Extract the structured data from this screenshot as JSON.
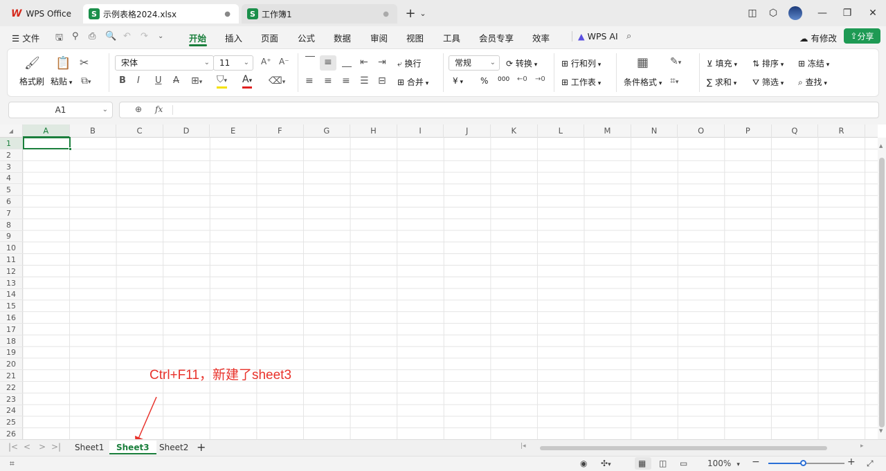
{
  "titlebar": {
    "app_tab": "WPS Office",
    "tabs": [
      {
        "icon": "S",
        "label": "示例表格2024.xlsx",
        "status": "●"
      },
      {
        "icon": "S",
        "label": "工作簿1",
        "status": "●"
      }
    ],
    "new_tab": "+",
    "tab_menu": "⌄"
  },
  "menubar": {
    "file": "文件",
    "items": [
      "开始",
      "插入",
      "页面",
      "公式",
      "数据",
      "审阅",
      "视图",
      "工具",
      "会员专享",
      "效率"
    ],
    "ai": "WPS AI",
    "changes": "有修改",
    "share": "分享"
  },
  "ribbon": {
    "format_painter": "格式刷",
    "paste": "粘贴",
    "font_name": "宋体",
    "font_size": "11",
    "wrap": "换行",
    "merge": "合并",
    "number_format": "常规",
    "convert": "转换",
    "rows_cols": "行和列",
    "worksheet": "工作表",
    "cond_format": "条件格式",
    "fill": "填充",
    "sort": "排序",
    "freeze": "冻结",
    "sum": "求和",
    "filter": "筛选",
    "find": "查找",
    "currency": "¥",
    "percent": "%",
    "thousands": "000"
  },
  "formula": {
    "cell_ref": "A1",
    "fx": "fx",
    "value": ""
  },
  "grid": {
    "columns": [
      "A",
      "B",
      "C",
      "D",
      "E",
      "F",
      "G",
      "H",
      "I",
      "J",
      "K",
      "L",
      "M",
      "N",
      "O",
      "P",
      "Q",
      "R"
    ],
    "rows": [
      "1",
      "2",
      "3",
      "4",
      "5",
      "6",
      "7",
      "8",
      "9",
      "10",
      "11",
      "12",
      "13",
      "14",
      "15",
      "16",
      "17",
      "18",
      "19",
      "20",
      "21",
      "22",
      "23",
      "24",
      "25",
      "26"
    ],
    "active_column": "A",
    "active_row": "1"
  },
  "sheets": {
    "tabs": [
      "Sheet1",
      "Sheet3",
      "Sheet2"
    ],
    "active": "Sheet3",
    "add": "+"
  },
  "status": {
    "zoom": "100%"
  },
  "annotation": "Ctrl+F11，新建了sheet3",
  "colors": {
    "accent": "#1a7f3c",
    "annotation": "#e8322b",
    "share": "#1e9a54"
  }
}
